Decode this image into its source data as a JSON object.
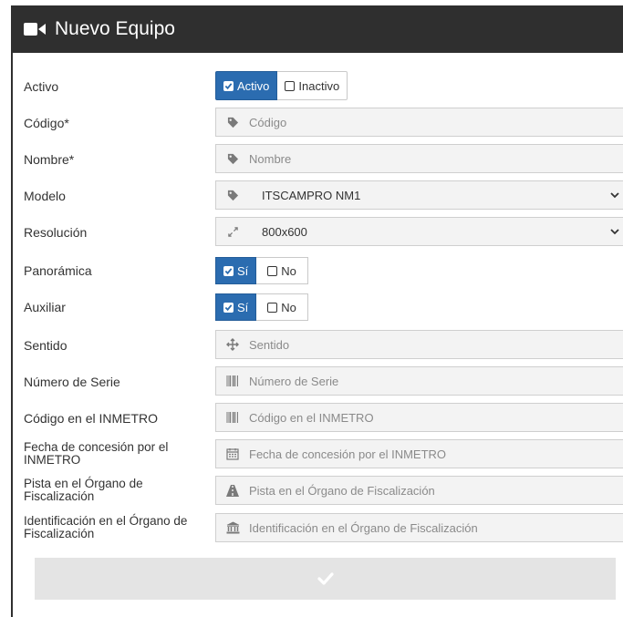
{
  "header": {
    "title": "Nuevo Equipo",
    "icon": "video-camera-icon"
  },
  "form": {
    "activo": {
      "label": "Activo",
      "options": [
        "Activo",
        "Inactivo"
      ],
      "selected": "Activo"
    },
    "codigo": {
      "label": "Código*",
      "placeholder": "Código",
      "icon": "tag-icon"
    },
    "nombre": {
      "label": "Nombre*",
      "placeholder": "Nombre",
      "icon": "tag-icon"
    },
    "modelo": {
      "label": "Modelo",
      "value": "ITSCAMPRO NM1",
      "icon": "tag-icon"
    },
    "resolucion": {
      "label": "Resolución",
      "value": "800x600",
      "icon": "expand-icon"
    },
    "panoramica": {
      "label": "Panorámica",
      "options": [
        "Sí",
        "No"
      ],
      "selected": "Sí"
    },
    "auxiliar": {
      "label": "Auxiliar",
      "options": [
        "Sí",
        "No"
      ],
      "selected": "Sí"
    },
    "sentido": {
      "label": "Sentido",
      "placeholder": "Sentido",
      "icon": "arrows-icon"
    },
    "numero_serie": {
      "label": "Número de Serie",
      "placeholder": "Número de Serie",
      "icon": "barcode-icon"
    },
    "codigo_inmetro": {
      "label": "Código en el INMETRO",
      "placeholder": "Código en el INMETRO",
      "icon": "barcode-icon"
    },
    "fecha_concesion": {
      "label": "Fecha de concesión por el INMETRO",
      "placeholder": "Fecha de concesión por el INMETRO",
      "icon": "calendar-icon"
    },
    "pista": {
      "label": "Pista en el Órgano de Fiscalización",
      "placeholder": "Pista en el Órgano de Fiscalización",
      "icon": "road-icon"
    },
    "identificacion": {
      "label": "Identificación en el Órgano de Fiscalización",
      "placeholder": "Identificación en el Órgano de Fiscalización",
      "icon": "institution-icon"
    }
  },
  "submit": {
    "icon": "check-icon"
  },
  "colors": {
    "header_bg": "#2f2f2f",
    "accent": "#2b6cb0",
    "input_bg": "#f3f3f3",
    "submit_bg": "#e4e4e4"
  }
}
